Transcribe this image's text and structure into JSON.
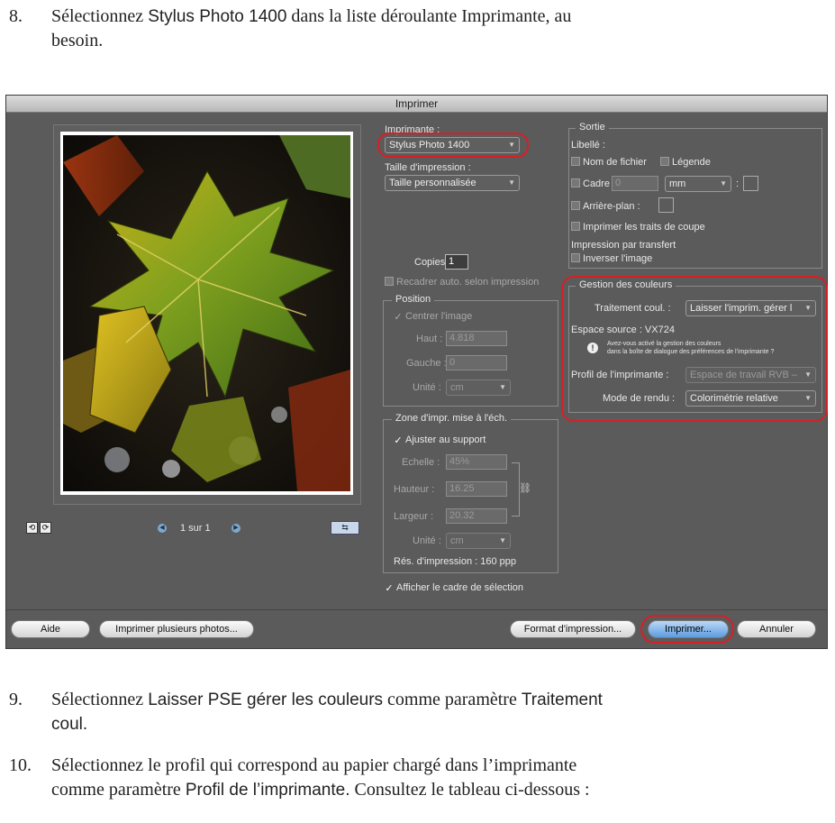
{
  "steps": {
    "s8": {
      "num": "8.",
      "pre": "Sélectionnez ",
      "ui": "Stylus Photo 1400",
      "post": " dans la liste déroulante Imprimante, au",
      "line2": "besoin."
    },
    "s9": {
      "num": "9.",
      "pre": "Sélectionnez ",
      "ui1": "Laisser PSE gérer les couleurs",
      "mid": " comme paramètre ",
      "ui2a": "Traitement",
      "ui2b": "coul."
    },
    "s10": {
      "num": "10.",
      "line1": "Sélectionnez le profil qui correspond au papier chargé dans l’imprimante",
      "pre2": "comme paramètre ",
      "ui": "Profil de l’imprimante.",
      "post2": " Consultez le tableau ci-dessous :"
    }
  },
  "dialog": {
    "title": "Imprimer",
    "preview": {
      "page_label": "1 sur 1"
    },
    "printer": {
      "label": "Imprimante :",
      "value": "Stylus Photo 1400"
    },
    "size": {
      "label": "Taille d'impression :",
      "value": "Taille personnalisée"
    },
    "copies": {
      "label": "Copies :",
      "value": "1"
    },
    "recadrer": "Recadrer auto. selon impression",
    "position": {
      "title": "Position",
      "center": "Centrer l'image",
      "haut_label": "Haut :",
      "haut_value": "4.818",
      "gauche_label": "Gauche :",
      "gauche_value": "0",
      "unite_label": "Unité :",
      "unite_value": "cm"
    },
    "zone": {
      "title": "Zone d'impr. mise à l'éch.",
      "fit": "Ajuster au support",
      "echelle_label": "Echelle :",
      "echelle_value": "45%",
      "hauteur_label": "Hauteur :",
      "hauteur_value": "16.25",
      "largeur_label": "Largeur :",
      "largeur_value": "20.32",
      "unite_label": "Unité :",
      "unite_value": "cm",
      "res": "Rés. d'impression : 160 ppp"
    },
    "afficher": "Afficher le cadre de sélection",
    "sortie": {
      "title": "Sortie",
      "libelle": "Libellé :",
      "nom_fichier": "Nom de fichier",
      "legende": "Légende",
      "cadre_label": "Cadre :",
      "cadre_value": "0",
      "cadre_unit": "mm",
      "arriere": "Arrière-plan :",
      "traits": "Imprimer les traits de coupe",
      "transfert": "Impression par transfert",
      "inverser": "Inverser l'image"
    },
    "couleurs": {
      "title": "Gestion des couleurs",
      "traitement_label": "Traitement coul. :",
      "traitement_value": "Laisser l'imprim. gérer l",
      "espace": "Espace source :  VX724",
      "note_line1": "Avez-vous activé la gestion des couleurs",
      "note_line2": "dans la boîte de dialogue des préférences de l'imprimante ?",
      "profil_label": "Profil de l'imprimante :",
      "profil_value": "Espace de travail RVB –",
      "rendu_label": "Mode de rendu :",
      "rendu_value": "Colorimétrie relative"
    },
    "buttons": {
      "aide": "Aide",
      "plusieurs": "Imprimer plusieurs photos...",
      "format": "Format d'impression...",
      "imprimer": "Imprimer...",
      "annuler": "Annuler"
    }
  }
}
